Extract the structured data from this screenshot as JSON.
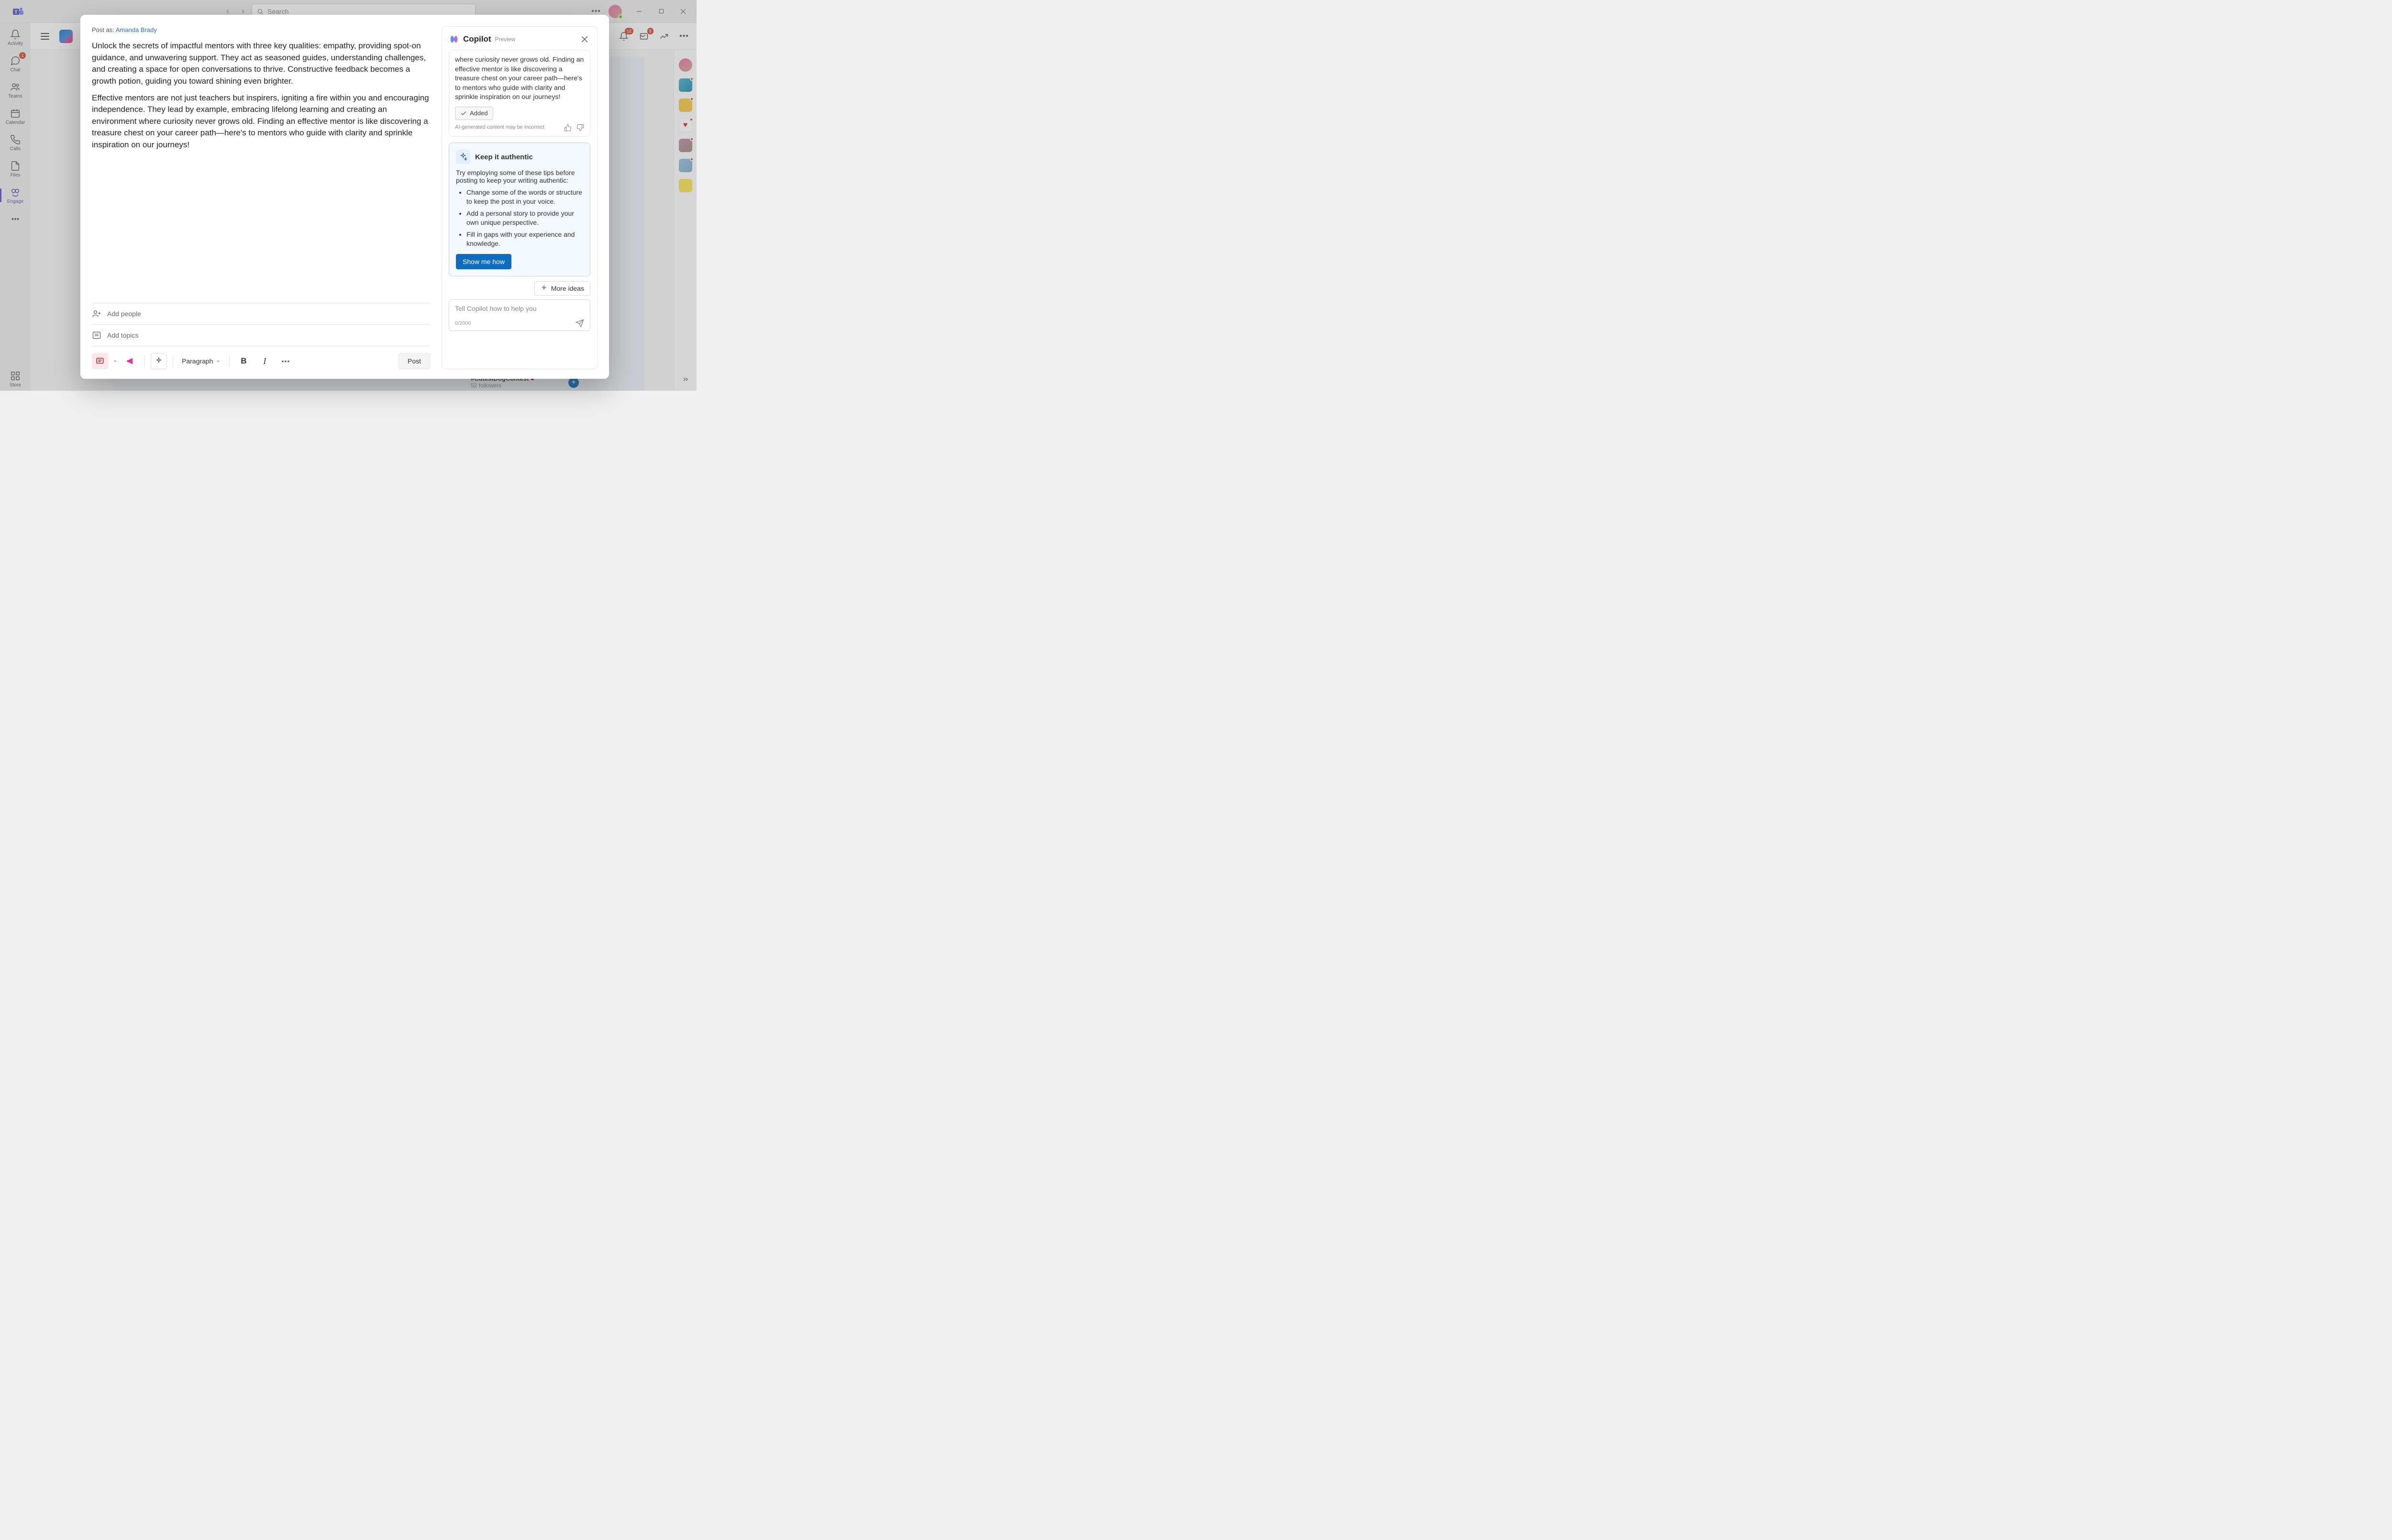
{
  "titlebar": {
    "search_placeholder": "Search"
  },
  "rail": {
    "activity": "Activity",
    "chat": "Chat",
    "chat_badge": "1",
    "teams": "Teams",
    "calendar": "Calendar",
    "calls": "Calls",
    "files": "Files",
    "engage": "Engage",
    "store": "Store"
  },
  "header_badges": {
    "bell": "12",
    "inbox": "5"
  },
  "background": {
    "hashtag": "#CutestDogContest",
    "followers": "52 followers"
  },
  "post": {
    "post_as_label": "Post as:",
    "author": "Amanda Brady",
    "para1": "Unlock the secrets of impactful mentors with three key qualities: empathy, providing spot-on guidance, and unwavering support. They act as seasoned guides, understanding challenges, and creating a space for open conversations to thrive. Constructive feedback becomes a growth potion, guiding you toward shining even brighter.",
    "para2": "Effective mentors are not just teachers but inspirers, igniting a fire within you and encouraging independence. They lead by example, embracing lifelong learning and creating an environment where curiosity never grows old. Finding an effective mentor is like discovering a treasure chest on your career path—here's to mentors who guide with clarity and sprinkle inspiration on our journeys!",
    "add_people": "Add people",
    "add_topics": "Add topics",
    "paragraph_label": "Paragraph",
    "post_button": "Post"
  },
  "copilot": {
    "title": "Copilot",
    "preview": "Preview",
    "msg_excerpt": "where curiosity never grows old. Finding an effective mentor is like discovering a treasure chest on your career path—here's to mentors who guide with clarity and sprinkle inspiration on our journeys!",
    "added_label": "Added",
    "disclaimer": "AI-generated content may be incorrect",
    "authentic_title": "Keep it authentic",
    "authentic_intro": "Try employing some of these tips before posting to keep your writing authentic:",
    "tips": [
      "Change some of the words or structure to keep the post in your voice.",
      "Add a personal story to provide your own unique perspective.",
      "Fill in gaps with your experience and knowledge."
    ],
    "show_how": "Show me how",
    "more_ideas": "More ideas",
    "input_placeholder": "Tell Copilot how to help you",
    "counter": "0/2000"
  }
}
